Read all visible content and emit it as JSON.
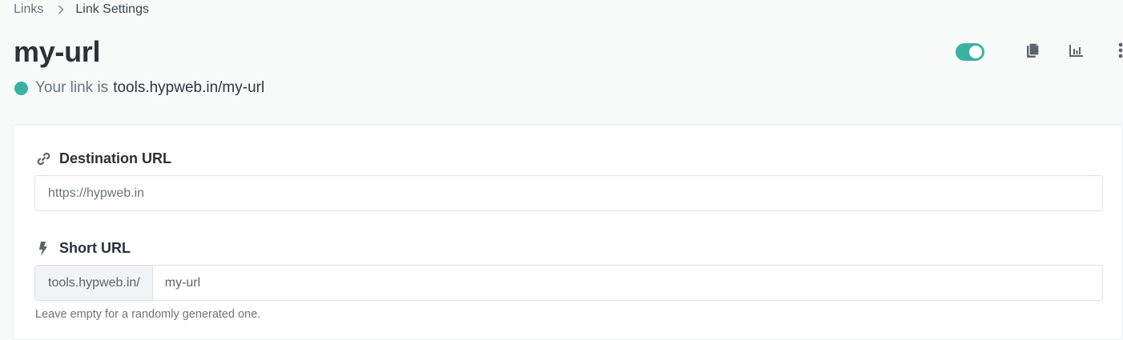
{
  "breadcrumb": {
    "parent": "Links",
    "current": "Link Settings"
  },
  "page": {
    "title": "my-url",
    "status_prefix": "Your link is",
    "status_url": "tools.hypweb.in/my-url"
  },
  "actions": {
    "toggle_on": true,
    "icons": [
      "toggle",
      "copy-icon",
      "analytics-icon",
      "more-vertical-icon"
    ]
  },
  "form": {
    "destination": {
      "label": "Destination URL",
      "value": "https://hypweb.in"
    },
    "short": {
      "label": "Short URL",
      "prefix": "tools.hypweb.in/",
      "value": "my-url",
      "help": "Leave empty for a randomly generated one."
    }
  },
  "colors": {
    "accent": "#39b2a3",
    "text": "#2f3440",
    "muted": "#6c727f",
    "background": "#f8fafa"
  }
}
